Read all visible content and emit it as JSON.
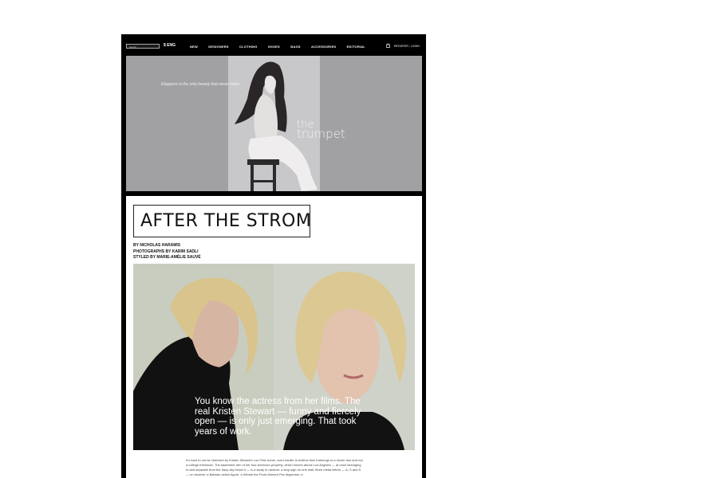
{
  "nav": {
    "search_placeholder": "search",
    "currency": "$ ENG",
    "links": [
      "NEW",
      "DESIGNERS",
      "CLOTHING",
      "SHOES",
      "BAGS",
      "ACCESSORIES",
      "EDITORIAL"
    ],
    "register": "REGISTER",
    "login": "LOGIN"
  },
  "hero": {
    "tagline": "Elegance is the only beauty that never fades",
    "brand_line1": "the",
    "brand_line2": "trumpet"
  },
  "article": {
    "title": "AFTER THE STROM",
    "credits": [
      "BY NICHOLAS HARAMIS",
      "PHOTOGRAPHS BY KARIM SADLI",
      "STYLED BY MARIE-AMÉLIE SAUVÉ"
    ],
    "pull_quote": "You  know the actress from her films. The real Kristen Stewart — funny and fiercely open — is only just emerging. That took years of work.",
    "body": "It's hard to not be charmed by Kristen Stewart's Los Feliz home, even harder to believe that it belongs to a movie star and not a college freshman. The basement den of her four-bedroom property, which hovers above Los Angeles — at once belonging to and separate from the hazy city below it — is a study in random: a stop sign on one wall, three metal letters — A, S and S — on another, a Batman action figure, a Winnie the Pooh-themed Pez dispenser, a"
  },
  "colors": {
    "frame": "#000000",
    "hero_bg": "#a1a0a3",
    "page_bg": "#ffffff"
  }
}
